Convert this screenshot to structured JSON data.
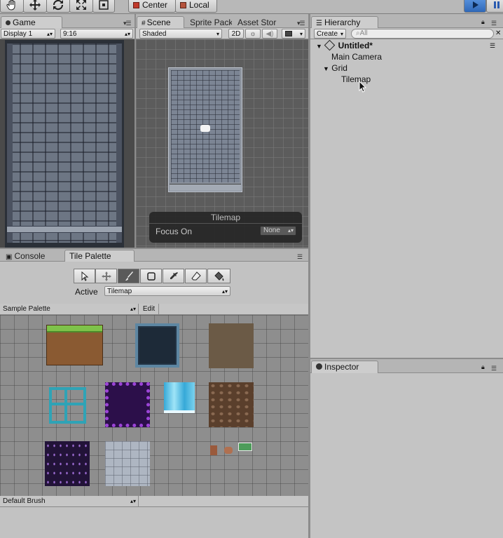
{
  "toolbar": {
    "tools": [
      "hand-tool",
      "move-tool",
      "rotate-tool",
      "scale-tool",
      "rect-tool"
    ],
    "pivot_label": "Center",
    "space_label": "Local"
  },
  "game": {
    "tab_label": "Game",
    "display": "Display 1",
    "aspect": "9:16"
  },
  "scene": {
    "tabs": [
      "Scene",
      "Sprite Pack",
      "Asset Stor"
    ],
    "shading": "Shaded",
    "mode_2d": "2D",
    "overlay_title": "Tilemap",
    "focus_label": "Focus On",
    "focus_value": "None"
  },
  "hierarchy": {
    "tab_label": "Hierarchy",
    "create_label": "Create",
    "search_placeholder": "All",
    "scene_name": "Untitled*",
    "items": [
      "Main Camera",
      "Grid",
      "Tilemap"
    ]
  },
  "inspector": {
    "tab_label": "Inspector"
  },
  "bottom": {
    "tabs": [
      "Console",
      "Tile Palette"
    ],
    "active_label": "Active",
    "active_value": "Tilemap",
    "palette_value": "Sample  Palette",
    "edit_label": "Edit",
    "brush_value": "Default Brush"
  },
  "colors": {
    "editor_bg": "#a2a2a2",
    "scene_grid": "#5c5c5c",
    "play_blue": "#3c78c8"
  }
}
